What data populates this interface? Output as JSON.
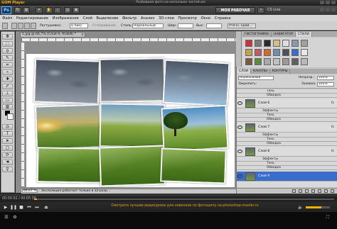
{
  "gom": {
    "logo": "GOM Player",
    "title": "Разбиваем фото на несколько частей.avi",
    "time": "00:00:02 / 00:05:38",
    "seek_fraction": 0.01,
    "volume_fraction": 0.65,
    "subtitle": "Смотрите лучшие видеоуроки для новичков по фотошопу на photoshop-master.ru"
  },
  "ps": {
    "logo": "Ps",
    "workspace": "МОЯ РАБОЧАЯ СРЕДА",
    "cs_live": "CS Live",
    "menu": [
      "Файл",
      "Редактирование",
      "Изображение",
      "Слой",
      "Выделение",
      "Фильтр",
      "Анализ",
      "3D-слои",
      "Просмотр",
      "Окно",
      "Справка"
    ],
    "options": {
      "feather_label": "Растушевка:",
      "feather_value": "0 пикс",
      "smooth_label": "Сглаживание",
      "style_label": "Стиль:",
      "style_value": "Нормальный",
      "width_label": "Шир:",
      "height_label": "Выс:",
      "refine_button": "Уточн. край..."
    },
    "doc_tab": "1.jpg @ 66,7% (Слой 9, RGB/8) *",
    "zoom": "66,67 %",
    "status": "Экспозиция работает только в 32-разр..."
  },
  "styles_panel": {
    "tabs": [
      "ГИСТОГРАММА",
      "НАВИГАТОР",
      "СТИЛИ"
    ],
    "swatches": [
      "#c8343a",
      "#7a7a7a",
      "#2a2a2a",
      "#d5c080",
      "#e0e0e0",
      "#8899aa",
      "#a0a0a0",
      "#c4a050",
      "#c05a6a",
      "#d46a2a",
      "#6e8fb0",
      "#505050",
      "#3a6ccc",
      "#e8e8e8",
      "#7a5a3a",
      "#5a8a3a",
      "#aaaaaa",
      "#c0c0c0",
      "#9a9a9a",
      "#606060",
      "#b8b8b8"
    ]
  },
  "layers_panel": {
    "tabs": [
      "СЛОИ",
      "КАНАЛЫ",
      "КОНТУРЫ"
    ],
    "blend_mode": "Нормальный",
    "opacity_label": "Непрозр.:",
    "opacity_value": "100%",
    "lock_label": "Закрепить:",
    "fill_label": "Заливка:",
    "fill_value": "100%",
    "layers": [
      {
        "name": "",
        "effects": [
          "Тень",
          "Обводка"
        ]
      },
      {
        "name": "Слой 6",
        "effects_label": "Эффекты",
        "effects": [
          "Тень",
          "Обводка"
        ]
      },
      {
        "name": "Слой 7",
        "effects_label": "Эффекты",
        "effects": [
          "Тень",
          "Обводка"
        ]
      },
      {
        "name": "Слой 8",
        "effects_label": "Эффекты",
        "effects": [
          "Тень",
          "Обводка"
        ]
      },
      {
        "name": "Слой 9",
        "selected": true
      }
    ]
  }
}
